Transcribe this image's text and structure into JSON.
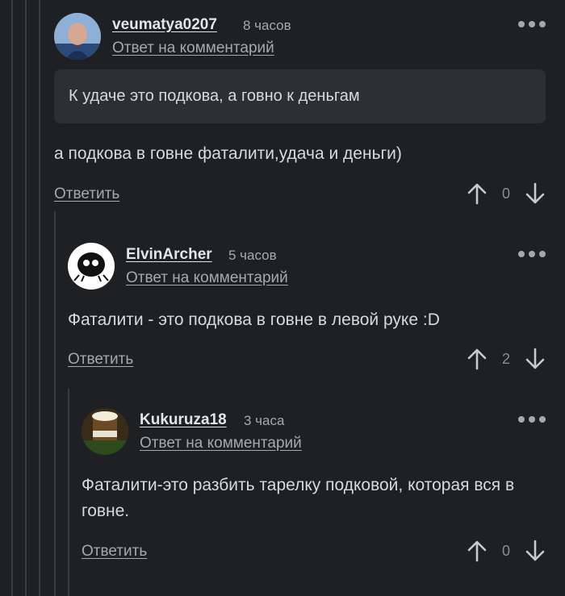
{
  "comments": [
    {
      "username": "veumatya0207",
      "time": "8 часов",
      "reply_link": "Ответ на комментарий",
      "quote": "К удаче это подкова, а говно к деньгам",
      "text": "а подкова в говне фаталити,удача и деньги)",
      "answer": "Ответить",
      "votes": "0"
    },
    {
      "username": "ElvinArcher",
      "time": "5 часов",
      "reply_link": "Ответ на комментарий",
      "text": "Фаталити - это подкова в говне в левой руке :D",
      "answer": "Ответить",
      "votes": "2"
    },
    {
      "username": "Kukuruza18",
      "time": "3 часа",
      "reply_link": "Ответ на комментарий",
      "text": "Фаталити-это разбить тарелку подковой, которая вся в говне.",
      "answer": "Ответить",
      "votes": "0"
    }
  ],
  "colors": {
    "background": "#1f2023",
    "quote_bg": "#2e2f33",
    "text": "#d8d9dc",
    "muted": "#a7a8ad",
    "thread_line": "#3a3b40"
  },
  "icons": [
    "more-icon",
    "upvote-arrow-icon",
    "downvote-arrow-icon"
  ]
}
